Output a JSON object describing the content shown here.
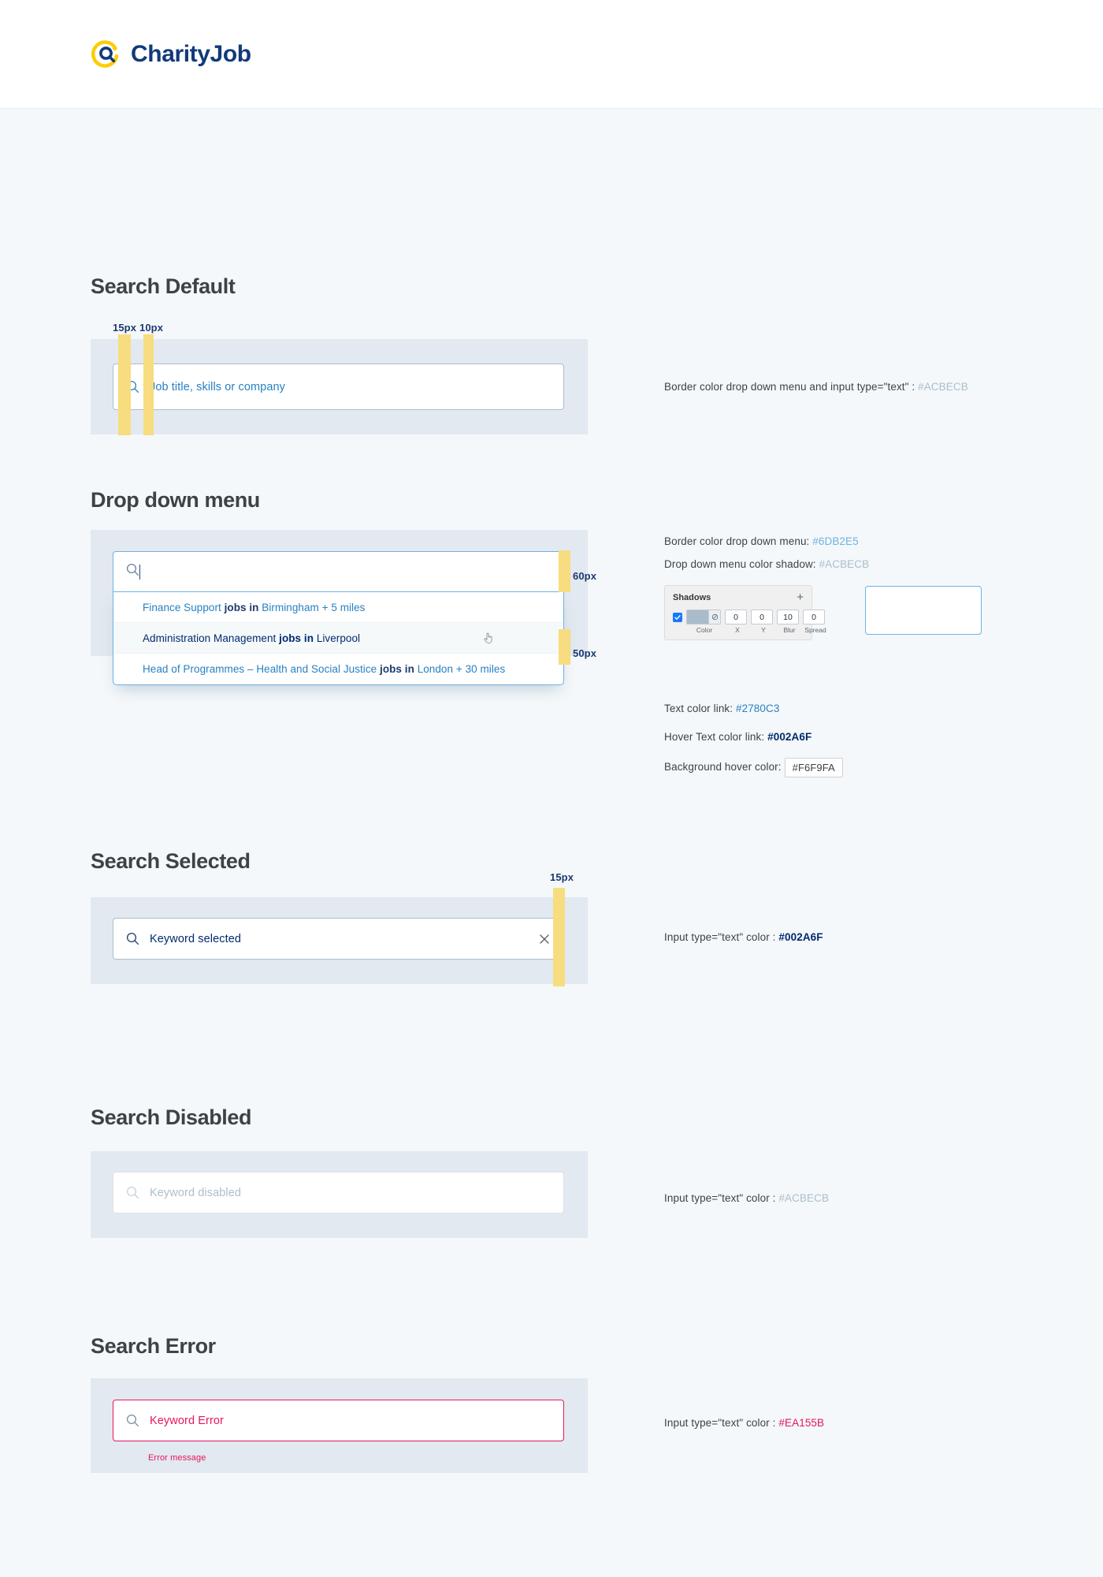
{
  "header": {
    "brand": "CharityJob",
    "logo_icon": "magnifier-circle-logo",
    "brand_color": "#123a7a",
    "accent_color": "#ffcc00"
  },
  "sections": {
    "search_default": {
      "title": "Search Default",
      "measurements": [
        {
          "label": "15px"
        },
        {
          "label": "10px"
        }
      ],
      "input": {
        "icon": "search-icon",
        "placeholder": "Job title, skills or company",
        "value": ""
      },
      "note": {
        "text": "Border color drop down menu and input type=\"text\" : ",
        "hex": "#ACBECB"
      }
    },
    "dropdown": {
      "title": "Drop down menu",
      "input": {
        "icon": "search-icon",
        "value": "",
        "caret_visible": true
      },
      "measurements": [
        {
          "label": "60px"
        },
        {
          "label": "50px"
        }
      ],
      "items": [
        {
          "prefix": "Finance Support",
          "middle": "jobs in",
          "suffix": "Birmingham + 5 miles",
          "hovered": false
        },
        {
          "prefix": "Administration Management",
          "middle": "jobs in",
          "suffix": "Liverpool",
          "hovered": true
        },
        {
          "prefix": "Head of Programmes – Health and Social Justice",
          "middle": "jobs in",
          "suffix": "London + 30 miles",
          "hovered": false
        }
      ],
      "cursor_icon": "pointer-hand-icon",
      "notes": {
        "border": {
          "text": "Border color drop down menu: ",
          "hex": "#6DB2E5"
        },
        "shadow": {
          "text": "Drop down menu color shadow: ",
          "hex": "#ACBECB"
        },
        "text_link": {
          "text": "Text color link: ",
          "hex": "#2780C3"
        },
        "hover_text_link": {
          "text": "Hover Text color link: ",
          "hex": "#002A6F"
        },
        "background_hover": {
          "text": "Background hover color:",
          "hex": "#F6F9FA"
        }
      },
      "shadow_widget": {
        "title": "Shadows",
        "add_icon": "plus-icon",
        "enabled": true,
        "color_swatch": "#A9BCCB",
        "eye_icon": "eyedropper-icon",
        "x": "0",
        "y": "0",
        "blur": "10",
        "spread": "0",
        "labels": {
          "color": "Color",
          "x": "X",
          "y": "Y",
          "blur": "Blur",
          "spread": "Spread"
        }
      }
    },
    "search_selected": {
      "title": "Search Selected",
      "measurements": [
        {
          "label": "15px"
        }
      ],
      "input": {
        "icon": "search-icon",
        "value": "Keyword selected",
        "clear_icon": "close-icon"
      },
      "note": {
        "text": "Input type=\"text\" color : ",
        "hex": "#002A6F"
      }
    },
    "search_disabled": {
      "title": "Search Disabled",
      "input": {
        "icon": "search-icon",
        "placeholder": "Keyword  disabled",
        "disabled": true
      },
      "note": {
        "text": "Input type=\"text\" color : ",
        "hex": "#ACBECB"
      }
    },
    "search_error": {
      "title": "Search Error",
      "input": {
        "icon": "search-icon",
        "value": "Keyword Error",
        "error": true
      },
      "error_message": "Error message",
      "note": {
        "text": "Input type=\"text\" color : ",
        "hex": "#EA155B"
      }
    }
  }
}
